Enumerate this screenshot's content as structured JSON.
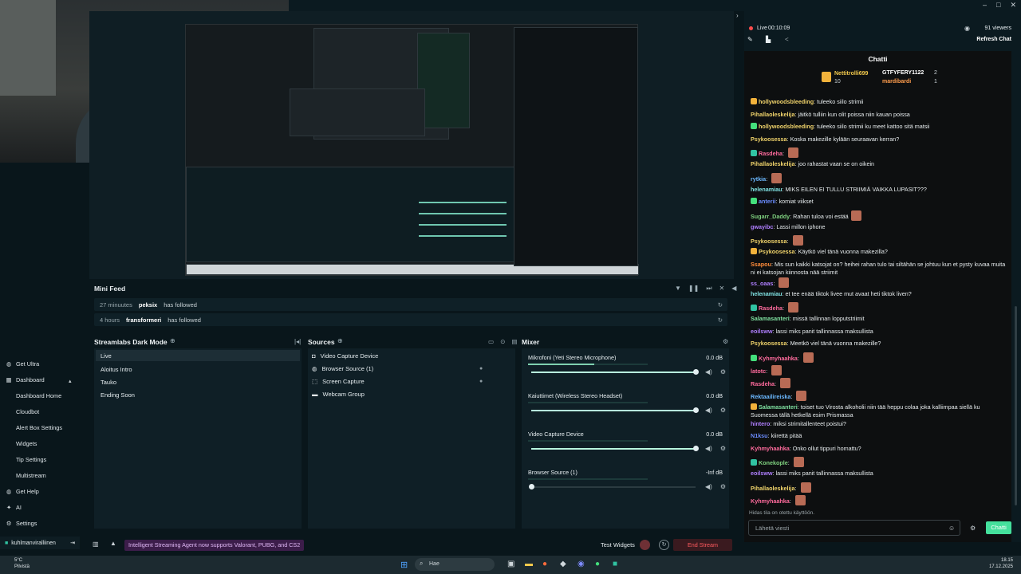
{
  "window": {
    "controls": [
      "–",
      "□",
      "✕"
    ]
  },
  "mini_feed": {
    "title": "Mini Feed",
    "items": [
      {
        "ago": "27 minuutes",
        "user": "peksix",
        "action": "has followed"
      },
      {
        "ago": "4 hours",
        "user": "fransformeri",
        "action": "has followed"
      }
    ]
  },
  "scenes": {
    "title": "Streamlabs Dark Mode",
    "items": [
      "Live",
      "Aloitus Intro",
      "Tauko",
      "Ending Soon"
    ]
  },
  "sources": {
    "title": "Sources",
    "items": [
      "Video Capture Device",
      "Browser Source (1)",
      "Screen Capture",
      "Webcam Group"
    ]
  },
  "mixer": {
    "title": "Mixer",
    "channels": [
      {
        "name": "Mikrofoni (Yeti Stereo Microphone)",
        "db": "0.0 dB",
        "level": 0.55,
        "volume": 1.0
      },
      {
        "name": "Kaiuttimet (Wireless Stereo Headset)",
        "db": "0.0 dB",
        "level": 0.0,
        "volume": 1.0
      },
      {
        "name": "Video Capture Device",
        "db": "0.0 dB",
        "level": 0.0,
        "volume": 1.0
      },
      {
        "name": "Browser Source (1)",
        "db": "-Inf dB",
        "level": 0.0,
        "volume": 0.0
      }
    ]
  },
  "sidebar": {
    "items": [
      {
        "label": "Get Ultra",
        "sub": false
      },
      {
        "label": "Dashboard",
        "sub": false
      },
      {
        "label": "Dashboard Home",
        "sub": true
      },
      {
        "label": "Cloudbot",
        "sub": true
      },
      {
        "label": "Alert Box Settings",
        "sub": true
      },
      {
        "label": "Widgets",
        "sub": true
      },
      {
        "label": "Tip Settings",
        "sub": true
      },
      {
        "label": "Multistream",
        "sub": true
      },
      {
        "label": "Get Help",
        "sub": false
      },
      {
        "label": "AI",
        "sub": false
      },
      {
        "label": "Settings",
        "sub": false
      }
    ],
    "account": "kuhlmanviralliinen"
  },
  "bottombar": {
    "notice": "Intelligent Streaming Agent now supports Valorant, PUBG, and CS2",
    "test_widgets": "Test Widgets",
    "end_stream": "End Stream"
  },
  "stream_status": {
    "live_label": "Live",
    "time": "00:10:09",
    "viewers": "91 viewers",
    "refresh_chat": "Refresh Chat"
  },
  "chat": {
    "title": "Chatti",
    "leaderboard": [
      {
        "name": "Nettitrolli699",
        "value": "10"
      },
      {
        "name": "GTFYFERY1122",
        "value": "2"
      },
      {
        "name": "mardibardi",
        "value": "1"
      }
    ],
    "messages": [
      {
        "user": "hollywoodsbleeding",
        "text": "tuleeko siilo strimii",
        "color": "#f0d36b",
        "emote": false
      },
      {
        "user": "Pihallaoleskelija",
        "text": "jäitkö tulliin kun olit poissa niin kauan poissa",
        "color": "#f0d36b",
        "emote": false
      },
      {
        "user": "hollywoodsbleeding",
        "text": "tuleeko siilo strimii ku meet kattoo sitä matsii",
        "color": "#f0d36b",
        "emote": false
      },
      {
        "user": "Psykoosessa",
        "text": "Koska makezille kylään seuraavan kerran?",
        "color": "#f0d36b",
        "emote": false
      },
      {
        "user": "Rasdeha",
        "text": "",
        "color": "#ff6b9d",
        "emote": true
      },
      {
        "user": "Pihallaoleskelija",
        "text": "joo rahastat vaan se on oikein",
        "color": "#f0d36b",
        "emote": false
      },
      {
        "user": "rytkia",
        "text": "",
        "color": "#6bb8ff",
        "emote": true
      },
      {
        "user": "helenamiau",
        "text": "MIKS EILEN EI TULLU STRIIMIÄ VAIKKA LUPASIT???",
        "color": "#7fe0e0",
        "emote": false
      },
      {
        "user": "anterii",
        "text": "komiat viikset",
        "color": "#6b8cff",
        "emote": false
      },
      {
        "user": "Sugarr_Daddy",
        "text": "Rahan tuloa voi estää",
        "color": "#7fd17f",
        "emote": true
      },
      {
        "user": "gwayibc",
        "text": "Lassi millon iphone",
        "color": "#b07fff",
        "emote": false
      },
      {
        "user": "Psykoosessa",
        "text": "",
        "color": "#f0d36b",
        "emote": true
      },
      {
        "user": "Psykoosessa",
        "text": "Käytkö viel tänä vuonna makezilla?",
        "color": "#f0d36b",
        "emote": false
      },
      {
        "user": "Ssapou",
        "text": "Mis sun kaikki katsojat on? heihei rahan tulo tai siltähän se johtuu kun et pysty kuvaa muita ni ei katsojan kiinnosta nää striimit",
        "color": "#ff8c3b",
        "emote": false
      },
      {
        "user": "ss_oaas",
        "text": "",
        "color": "#b07fff",
        "emote": true
      },
      {
        "user": "helenamiau",
        "text": "et tee enää tiktok livee mut avaat heti tiktok liven?",
        "color": "#7fe0e0",
        "emote": false
      },
      {
        "user": "Rasdeha",
        "text": "",
        "color": "#ff6b9d",
        "emote": true
      },
      {
        "user": "Salamasanteri",
        "text": "missä tallinnan lopputstriimit",
        "color": "#7fe0a0",
        "emote": false
      },
      {
        "user": "eoilsww",
        "text": "lassi miks panit tallinnassa maksullista",
        "color": "#b07fff",
        "emote": false
      },
      {
        "user": "Psykoosessa",
        "text": "Meetkö viel tänä vuonna makezille?",
        "color": "#f0d36b",
        "emote": false
      },
      {
        "user": "Kyhmyhaahka",
        "text": "",
        "color": "#ff6b9d",
        "emote": true
      },
      {
        "user": "latotc",
        "text": "",
        "color": "#ff6b9d",
        "emote": true
      },
      {
        "user": "Rasdeha",
        "text": "",
        "color": "#ff6b9d",
        "emote": true
      },
      {
        "user": "Rektaailireiska",
        "text": "",
        "color": "#6bb8ff",
        "emote": true
      },
      {
        "user": "Salamasanteri",
        "text": "toiset tuo Virosta alkoholii niin tää heppu colaa joka kalliimpaa siellä ku Suomessa tällä hetkellä esim Prismassa",
        "color": "#7fe0a0",
        "emote": false
      },
      {
        "user": "hintero",
        "text": "miksi strimitallenteet poistui?",
        "color": "#b07fff",
        "emote": false
      },
      {
        "user": "N1ksu",
        "text": "kiirettä pitää",
        "color": "#6b8cff",
        "emote": false
      },
      {
        "user": "Kyhmyhaahka",
        "text": "Onko ollut tippuri homattu?",
        "color": "#ff6b9d",
        "emote": false
      },
      {
        "user": "Konekople",
        "text": "",
        "color": "#7fd17f",
        "emote": true
      },
      {
        "user": "eoilsww",
        "text": "lassi miks panit tallinnassa maksullista",
        "color": "#b07fff",
        "emote": false
      },
      {
        "user": "Pihallaoleskelija",
        "text": "",
        "color": "#f0d36b",
        "emote": true
      },
      {
        "user": "Kyhmyhaahka",
        "text": "",
        "color": "#ff6b9d",
        "emote": true
      }
    ],
    "note": "Hidas tila on otettu käyttöön.",
    "input_placeholder": "Lähetä viesti",
    "send": "Chatti"
  },
  "taskbar": {
    "weather_temp": "5°C",
    "weather_desc": "Pilvistä",
    "search_placeholder": "Hae",
    "time": "18.15",
    "date": "17.12.2025"
  },
  "colors": {
    "accent": "#31c3a2",
    "live": "#ff4d4d",
    "end_stream": "#ff5a5f",
    "send": "#44e09c"
  }
}
